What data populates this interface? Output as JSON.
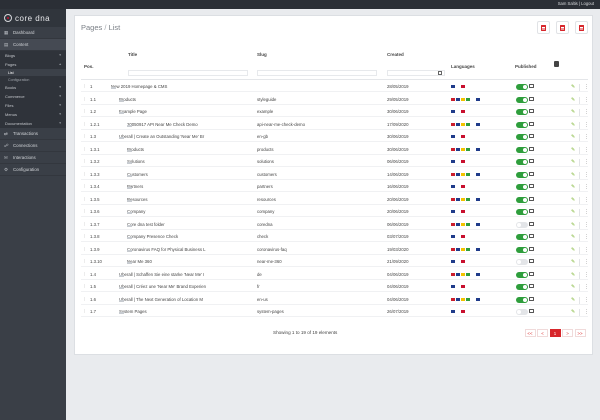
{
  "topbar": {
    "user_text": "Sam Saltis | Logout"
  },
  "brand": {
    "name": "core dna"
  },
  "sidebar": {
    "items": [
      {
        "label": "Dashboard",
        "icon": "dashboard-icon"
      },
      {
        "label": "Content",
        "icon": "content-icon"
      }
    ],
    "sub_items": [
      {
        "label": "Blogs"
      },
      {
        "label": "Pages"
      }
    ],
    "pages_children": [
      "List",
      "Configuration"
    ],
    "more_sub_items": [
      "Books",
      "Commerce",
      "Files",
      "Menus",
      "Documentation"
    ],
    "bottom_items": [
      {
        "label": "Transactions",
        "icon": "transactions-icon"
      },
      {
        "label": "Connections",
        "icon": "connections-icon"
      },
      {
        "label": "Interactions",
        "icon": "interactions-icon"
      },
      {
        "label": "Configuration",
        "icon": "configuration-icon"
      }
    ]
  },
  "page": {
    "breadcrumb_root": "Pages",
    "breadcrumb_sep": "/",
    "breadcrumb_current": "List"
  },
  "columns": {
    "pos": "Pos.",
    "title": "Title",
    "slug": "Slug",
    "created": "Created",
    "languages": "Languages",
    "published": "Published"
  },
  "rows": [
    {
      "pos": "1",
      "title": "New 2019 Homepage & CMS",
      "slug": "",
      "created": "28/05/2019",
      "indent": 0,
      "folder": true,
      "published": true
    },
    {
      "pos": "1.1",
      "title": "Products",
      "slug": "styleguide",
      "created": "29/05/2019",
      "indent": 1,
      "folder": false,
      "published": true
    },
    {
      "pos": "1.2",
      "title": "Example Page",
      "slug": "example",
      "created": "30/06/2019",
      "indent": 1,
      "folder": true,
      "published": true
    },
    {
      "pos": "1.2.1",
      "title": "20050917 API Near Me Check Demo",
      "slug": "api-near-me-check-demo",
      "created": "17/09/2020",
      "indent": 2,
      "folder": false,
      "published": true
    },
    {
      "pos": "1.3",
      "title": "Uberall | Create an Outstanding 'Near Me' Br",
      "slug": "en-gb",
      "created": "30/06/2019",
      "indent": 1,
      "folder": true,
      "published": true
    },
    {
      "pos": "1.3.1",
      "title": "Products",
      "slug": "products",
      "created": "30/06/2019",
      "indent": 2,
      "folder": true,
      "published": true
    },
    {
      "pos": "1.3.2",
      "title": "Solutions",
      "slug": "solutions",
      "created": "06/06/2019",
      "indent": 2,
      "folder": true,
      "published": true
    },
    {
      "pos": "1.3.3",
      "title": "Customers",
      "slug": "customers",
      "created": "14/06/2019",
      "indent": 2,
      "folder": true,
      "published": true
    },
    {
      "pos": "1.3.4",
      "title": "Partners",
      "slug": "partners",
      "created": "16/06/2019",
      "indent": 2,
      "folder": true,
      "published": true
    },
    {
      "pos": "1.3.5",
      "title": "Resources",
      "slug": "resources",
      "created": "20/06/2019",
      "indent": 2,
      "folder": true,
      "published": true
    },
    {
      "pos": "1.3.6",
      "title": "Company",
      "slug": "company",
      "created": "20/06/2019",
      "indent": 2,
      "folder": true,
      "published": true
    },
    {
      "pos": "1.3.7",
      "title": "Core dna test folder",
      "slug": "coredna",
      "created": "06/06/2019",
      "indent": 2,
      "folder": false,
      "published": false
    },
    {
      "pos": "1.3.8",
      "title": "Company Presence Check",
      "slug": "check",
      "created": "03/07/2019",
      "indent": 2,
      "folder": false,
      "published": true
    },
    {
      "pos": "1.3.9",
      "title": "Coronavirus FAQ for Physical Business L",
      "slug": "coronavirus-faq",
      "created": "19/03/2020",
      "indent": 2,
      "folder": true,
      "published": true
    },
    {
      "pos": "1.3.10",
      "title": "Near Me 360",
      "slug": "near-me-360",
      "created": "21/09/2020",
      "indent": 2,
      "folder": true,
      "published": false
    },
    {
      "pos": "1.4",
      "title": "Uberall | Schaffen Sie eine starke 'Near Me' I",
      "slug": "de",
      "created": "04/06/2019",
      "indent": 1,
      "folder": true,
      "published": true
    },
    {
      "pos": "1.5",
      "title": "Uberall | Créez une 'Near Me' Brand Experien",
      "slug": "fr",
      "created": "04/06/2019",
      "indent": 1,
      "folder": true,
      "published": true
    },
    {
      "pos": "1.6",
      "title": "Uberall | The Next Generation of Location M",
      "slug": "en-us",
      "created": "04/06/2019",
      "indent": 1,
      "folder": true,
      "published": true
    },
    {
      "pos": "1.7",
      "title": "System Pages",
      "slug": "system-pages",
      "created": "26/07/2019",
      "indent": 1,
      "folder": true,
      "published": false
    }
  ],
  "footer": {
    "info": "Showing 1 to 19 of 19 elements",
    "pages": [
      "<<",
      "<",
      "1",
      ">",
      ">>"
    ]
  },
  "colors": {
    "accent": "#d7262b",
    "toggle_on": "#2e9e3c",
    "edit": "#7bb531"
  }
}
